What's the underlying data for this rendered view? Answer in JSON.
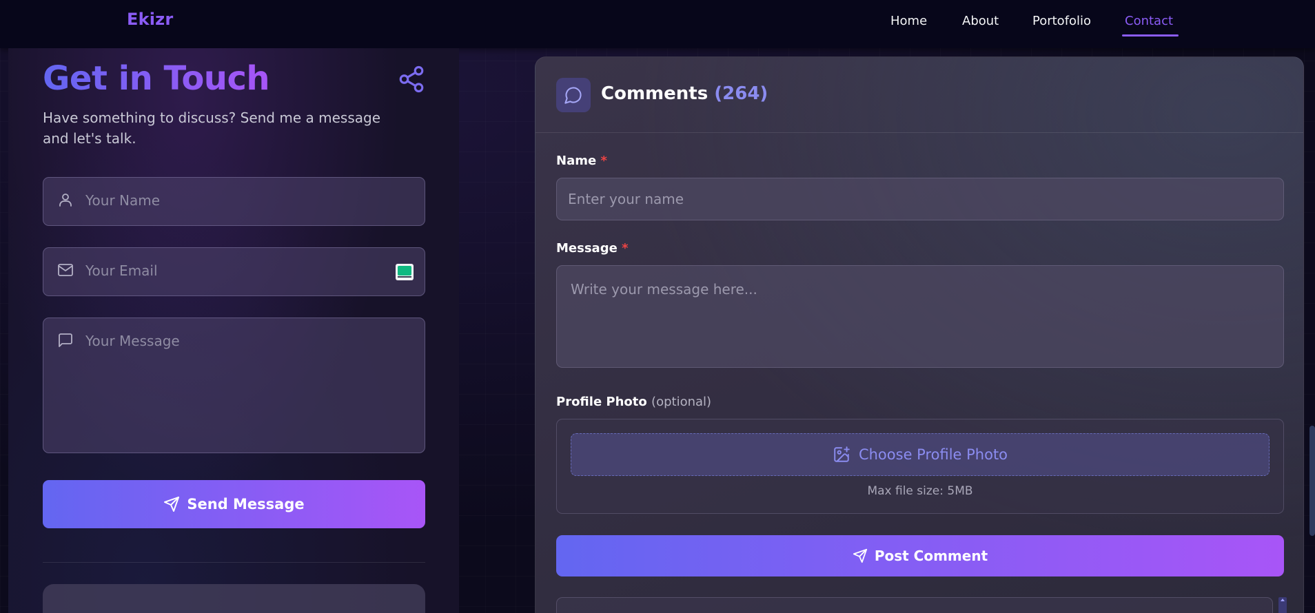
{
  "nav": {
    "brand": "Ekizr",
    "links": [
      {
        "label": "Home"
      },
      {
        "label": "About"
      },
      {
        "label": "Portofolio"
      },
      {
        "label": "Contact",
        "active": true
      }
    ]
  },
  "contact": {
    "title": "Get in Touch",
    "subtitle": "Have something to discuss? Send me a message and let's talk.",
    "name_placeholder": "Your Name",
    "email_placeholder": "Your Email",
    "message_placeholder": "Your Message",
    "send_label": "Send Message"
  },
  "comments": {
    "title": "Comments",
    "count": "(264)",
    "name_label": "Name",
    "required_mark": "*",
    "name_placeholder": "Enter your name",
    "message_label": "Message",
    "message_placeholder": "Write your message here...",
    "photo_label": "Profile Photo",
    "photo_optional": "(optional)",
    "choose_photo_label": "Choose Profile Photo",
    "max_file_size": "Max file size: 5MB",
    "post_label": "Post Comment"
  },
  "colors": {
    "accent": "#8b5cf6",
    "gradient_start": "#6366f1",
    "gradient_end": "#a855f7",
    "required": "#ef4444"
  },
  "icons": {
    "share": "share-icon",
    "user": "user-icon",
    "mail": "mail-icon",
    "message": "message-square-icon",
    "send": "send-icon",
    "chat": "chat-bubble-icon",
    "image_plus": "image-plus-icon"
  }
}
